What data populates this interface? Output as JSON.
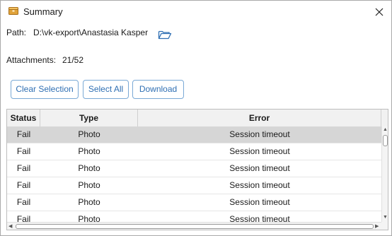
{
  "window": {
    "title": "Summary",
    "app_icon": "package-icon",
    "close_icon": "close-icon"
  },
  "path": {
    "label": "Path:",
    "value": "D:\\vk-export\\Anastasia Kasper",
    "open_icon": "folder-open-icon"
  },
  "attachments": {
    "label": "Attachments:",
    "value": "21/52"
  },
  "buttons": {
    "clear_selection": "Clear Selection",
    "select_all": "Select All",
    "download": "Download"
  },
  "table": {
    "columns": [
      "Status",
      "Type",
      "Error"
    ],
    "rows": [
      {
        "status": "Fail",
        "type": "Photo",
        "error": "Session timeout",
        "selected": true
      },
      {
        "status": "Fail",
        "type": "Photo",
        "error": "Session timeout",
        "selected": false
      },
      {
        "status": "Fail",
        "type": "Photo",
        "error": "Session timeout",
        "selected": false
      },
      {
        "status": "Fail",
        "type": "Photo",
        "error": "Session timeout",
        "selected": false
      },
      {
        "status": "Fail",
        "type": "Photo",
        "error": "Session timeout",
        "selected": false
      },
      {
        "status": "Fail",
        "type": "Photo",
        "error": "Session timeout",
        "selected": false
      }
    ]
  },
  "colors": {
    "accent": "#2f6fb3",
    "button_border": "#7aa9d6",
    "selected_row": "#d6d6d6"
  }
}
